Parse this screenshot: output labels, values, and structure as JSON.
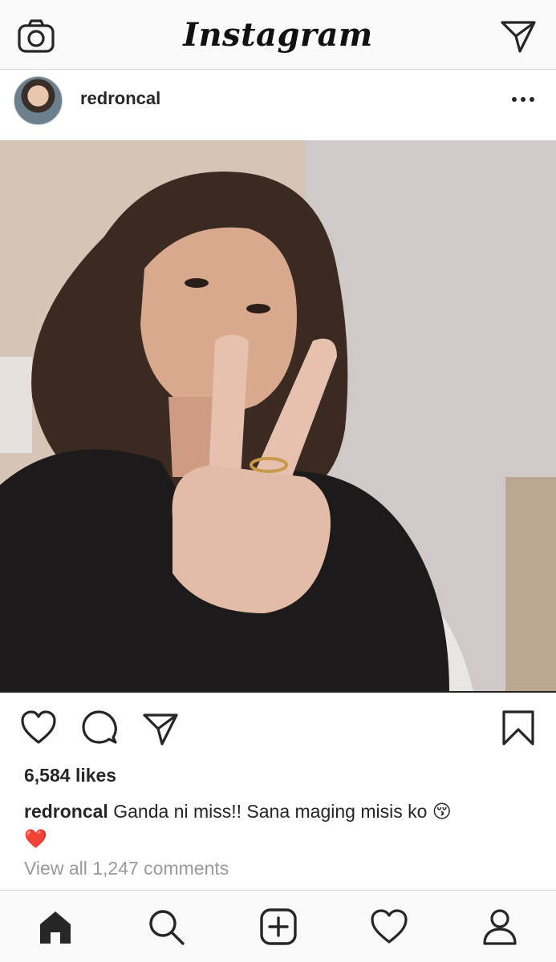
{
  "app": {
    "logo_text": "Instagram"
  },
  "topbar": {
    "camera_icon": "camera-icon",
    "direct_icon": "paper-plane-icon"
  },
  "post": {
    "username": "redroncal",
    "more_icon": "ellipsis-icon",
    "photo_description_icon": "photo",
    "actions": [
      "heart-icon",
      "comment-icon",
      "share-icon",
      "bookmark-icon"
    ],
    "likes": "6,584 likes",
    "caption_user": "redroncal",
    "caption_text": " Ganda ni miss!! Sana maging misis ko 😚",
    "caption_line2": "❤️",
    "view_comments": "View all 1,247 comments"
  },
  "bottom_nav": [
    "home-icon",
    "search-icon",
    "add-post-icon",
    "activity-heart-icon",
    "profile-icon"
  ],
  "colors": {
    "text": "#262626",
    "muted": "#999999",
    "bar_bg": "#fafafa",
    "divider": "#d8d8d8"
  }
}
